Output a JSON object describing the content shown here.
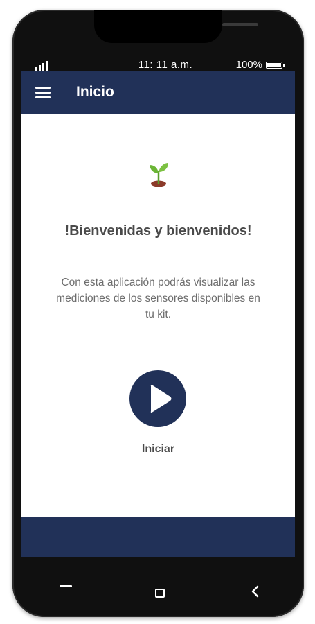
{
  "status_bar": {
    "time": "11: 11 a.m.",
    "battery": "100%",
    "icons": [
      "signal-icon",
      "battery-icon"
    ]
  },
  "app_bar": {
    "title": "Inicio",
    "menu_icon": "hamburger-menu-icon"
  },
  "welcome": {
    "icon": "sprout-icon",
    "title": "!Bienvenidas y bienvenidos!",
    "description": "Con esta aplicación podrás visualizar las mediciones de los sensores disponibles en tu kit."
  },
  "start": {
    "icon": "play-icon",
    "label": "Iniciar"
  },
  "nav_bar": {
    "icons": [
      "minimize-icon",
      "home-icon",
      "back-icon"
    ]
  },
  "colors": {
    "primary": "#213158",
    "text": "#4a4a4a",
    "muted_text": "#6d6d6d",
    "phone_body": "#101010"
  }
}
